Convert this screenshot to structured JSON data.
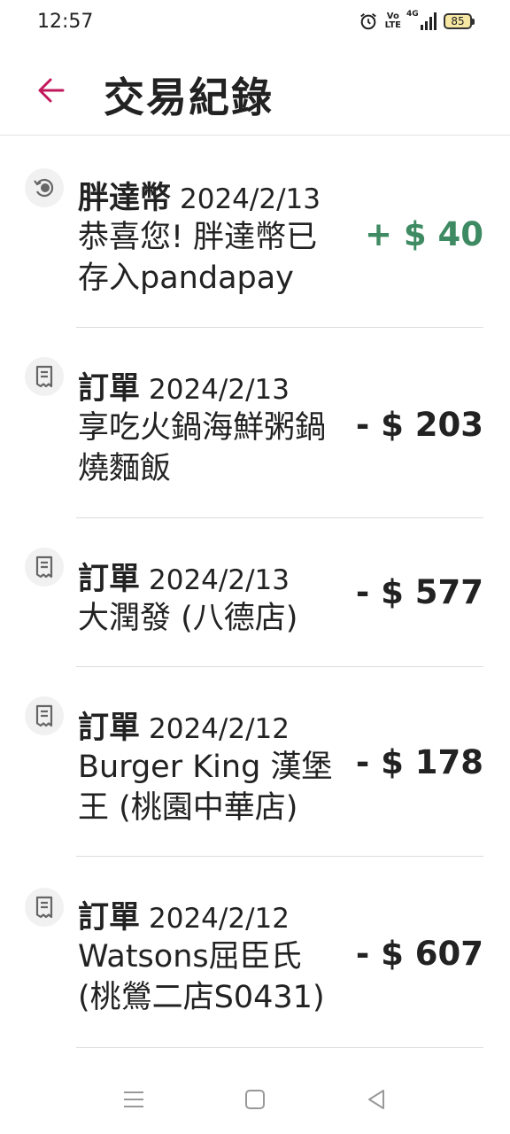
{
  "status_bar": {
    "time": "12:57",
    "volte_top": "Vo",
    "volte_bottom": "LTE",
    "network": "4G",
    "battery": "85",
    "icons": [
      "alarm-icon",
      "volte-icon",
      "signal-icon",
      "battery-icon"
    ]
  },
  "header": {
    "title": "交易紀錄",
    "back_icon": "arrow-left-icon",
    "accent_color": "#c2185b"
  },
  "transactions": [
    {
      "icon": "coin-refresh-icon",
      "type": "胖達幣",
      "date": "2024/2/13",
      "description_lines": [
        "恭喜您! 胖達幣已",
        "存入pandapay"
      ],
      "amount": "+ $ 40",
      "positive": true
    },
    {
      "icon": "receipt-icon",
      "type": "訂單",
      "date": "2024/2/13",
      "description_lines": [
        "享吃火鍋海鮮粥鍋",
        "燒麵飯"
      ],
      "amount": "- $ 203",
      "positive": false
    },
    {
      "icon": "receipt-icon",
      "type": "訂單",
      "date": "2024/2/13",
      "description_lines": [
        "大潤發 (八德店)"
      ],
      "amount": "- $ 577",
      "positive": false
    },
    {
      "icon": "receipt-icon",
      "type": "訂單",
      "date": "2024/2/12",
      "description_lines": [
        "Burger King 漢堡",
        "王 (桃園中華店)"
      ],
      "amount": "- $ 178",
      "positive": false
    },
    {
      "icon": "receipt-icon",
      "type": "訂單",
      "date": "2024/2/12",
      "description_lines": [
        "Watsons屈臣氏",
        "(桃鶯二店S0431)"
      ],
      "amount": "- $ 607",
      "positive": false
    }
  ],
  "colors": {
    "positive_amount": "#3e8a62",
    "text": "#222222",
    "divider": "#dcdcdc"
  },
  "nav_bar": {
    "icons": [
      "menu-icon",
      "home-square-icon",
      "back-triangle-icon"
    ]
  }
}
